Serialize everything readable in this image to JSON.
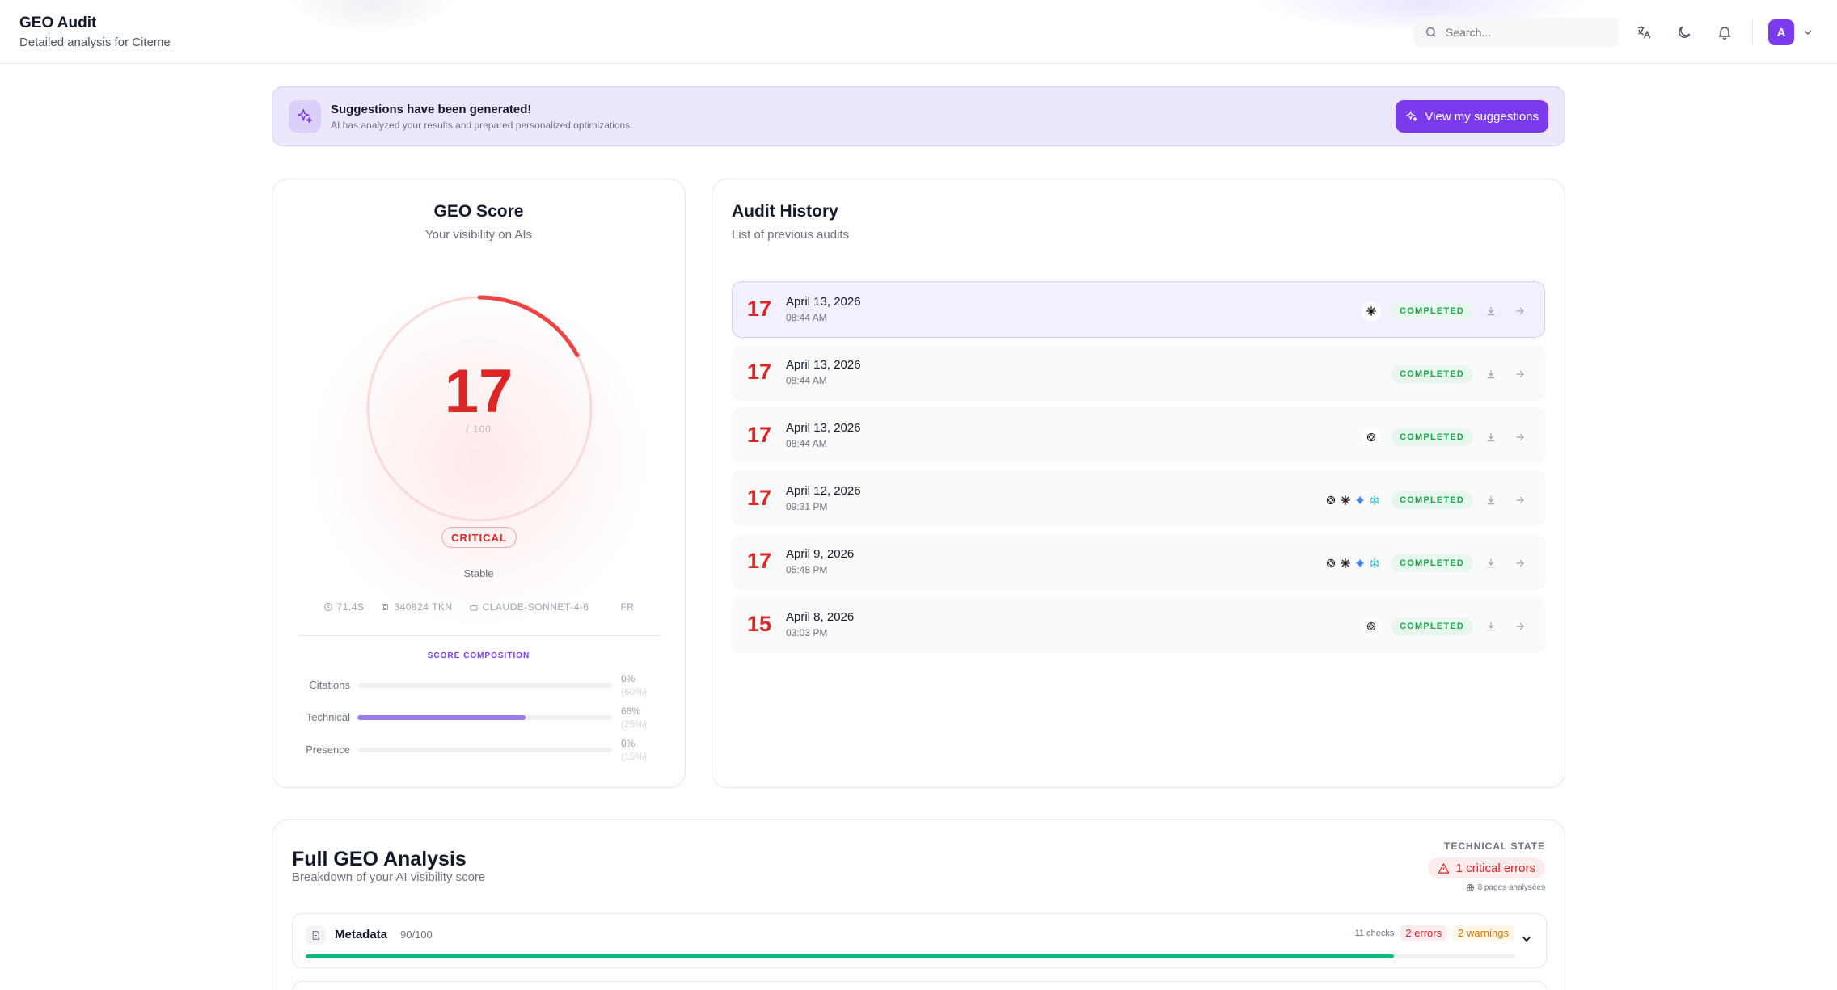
{
  "header": {
    "title": "GEO Audit",
    "subtitle": "Detailed analysis for Citeme",
    "search_placeholder": "Search...",
    "avatar_initial": "A"
  },
  "banner": {
    "title": "Suggestions have been generated!",
    "text": "AI has analyzed your results and prepared personalized optimizations.",
    "button_label": "View my suggestions"
  },
  "score": {
    "title": "GEO Score",
    "subtitle": "Your visibility on AIs",
    "value": 17,
    "value_text": "17",
    "max_text": "/ 100",
    "status": "CRITICAL",
    "trend": "Stable",
    "duration": "71.4S",
    "tokens": "340824 TKN",
    "model": "CLAUDE-SONNET-4-6",
    "lang": "FR",
    "composition_title": "SCORE COMPOSITION",
    "composition": [
      {
        "label": "Citations",
        "pct_value": 0,
        "pct": "0%",
        "weight": "(60%)"
      },
      {
        "label": "Technical",
        "pct_value": 66,
        "pct": "66%",
        "weight": "(25%)"
      },
      {
        "label": "Presence",
        "pct_value": 0,
        "pct": "0%",
        "weight": "(15%)"
      }
    ],
    "accent_color": "#dc2626"
  },
  "history": {
    "title": "Audit History",
    "subtitle": "List of previous audits",
    "status_label": "COMPLETED",
    "rows": [
      {
        "score": "17",
        "date": "April 13, 2026",
        "time": "08:44 AM",
        "models": [
          "claude"
        ],
        "active": true
      },
      {
        "score": "17",
        "date": "April 13, 2026",
        "time": "08:44 AM",
        "models": [],
        "active": false
      },
      {
        "score": "17",
        "date": "April 13, 2026",
        "time": "08:44 AM",
        "models": [
          "openai"
        ],
        "active": false
      },
      {
        "score": "17",
        "date": "April 12, 2026",
        "time": "09:31 PM",
        "models": [
          "openai",
          "claude",
          "gemini",
          "perplexity"
        ],
        "active": false
      },
      {
        "score": "17",
        "date": "April 9, 2026",
        "time": "05:48 PM",
        "models": [
          "openai",
          "claude",
          "gemini",
          "perplexity"
        ],
        "active": false
      },
      {
        "score": "15",
        "date": "April 8, 2026",
        "time": "03:03 PM",
        "models": [
          "openai"
        ],
        "active": false
      }
    ]
  },
  "analysis": {
    "title": "Full GEO Analysis",
    "subtitle": "Breakdown of your AI visibility score",
    "tech_state_label": "TECHNICAL STATE",
    "critical_errors": "1 critical errors",
    "pages_note": "8 pages analysées",
    "sections": [
      {
        "name": "Metadata",
        "score": "90/100",
        "score_value": 90,
        "checks": "11 checks",
        "errors": "2 errors",
        "warnings": "2 warnings"
      }
    ]
  }
}
